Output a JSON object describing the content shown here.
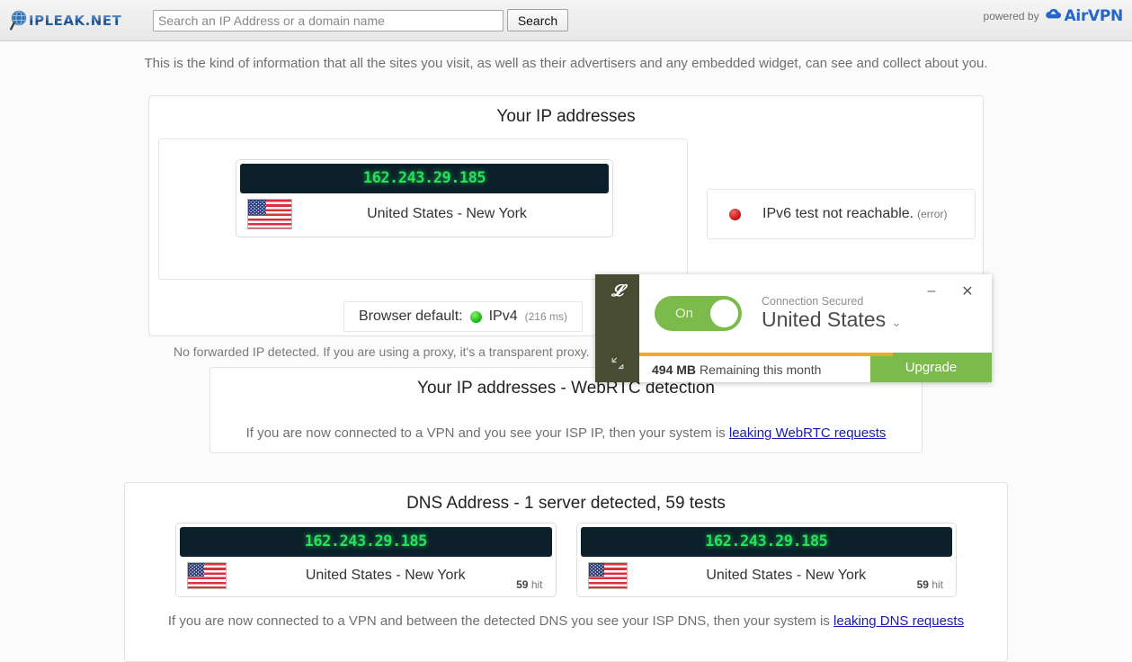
{
  "header": {
    "logo_text": "IPLEAK.NET",
    "logo_icon": "magnifier-globe-icon",
    "search_placeholder": "Search an IP Address or a domain name",
    "search_value": "",
    "search_button": "Search",
    "powered_by_label": "powered by",
    "brand_name": "AirVPN",
    "brand_icon": "airvpn-cloud-icon",
    "brand_color": "#2466c9"
  },
  "intro": "This is the kind of information that all the sites you visit, as well as their advertisers and any embedded widget, can see and collect about you.",
  "ip_panel": {
    "title": "Your IP addresses",
    "ip": "162.243.29.185",
    "location": "United States - New York",
    "flag_icon": "us-flag-icon",
    "forwarded_note": "No forwarded IP detected. If you are using a proxy, it's a transparent proxy.",
    "ipv6": {
      "status_icon": "red-dot-icon",
      "text": "IPv6 test not reachable.",
      "sub": "(error)",
      "color": "#c90d0d"
    },
    "browser_default": {
      "label": "Browser default:",
      "status_icon": "green-dot-icon",
      "value": "IPv4",
      "latency": "(216 ms)",
      "color": "#10b40e"
    }
  },
  "webrtc_panel": {
    "title": "Your IP addresses - WebRTC detection",
    "note_prefix": "If you are now connected to a VPN and you see your ISP IP, then your system is ",
    "link_text": "leaking WebRTC requests"
  },
  "dns_panel": {
    "title": "DNS Address - 1 server detected, 59 tests",
    "cards": [
      {
        "ip": "162.243.29.185",
        "location": "United States - New York",
        "hits": "59",
        "hits_label": "hit",
        "flag_icon": "us-flag-icon"
      },
      {
        "ip": "162.243.29.185",
        "location": "United States - New York",
        "hits": "59",
        "hits_label": "hit",
        "flag_icon": "us-flag-icon"
      }
    ],
    "note_prefix": "If you are now connected to a VPN and between the detected DNS you see your ISP DNS, then your system is ",
    "link_text": "leaking DNS requests"
  },
  "tunnelbear": {
    "logo_icon": "tunnelbear-t-icon",
    "resize_icon": "resize-diagonal-icon",
    "toggle_label": "On",
    "toggle_on": true,
    "toggle_color": "#7cba4c",
    "status_small": "Connection Secured",
    "country": "United States",
    "country_chevron_icon": "chevron-down-icon",
    "minimize_icon": "minimize-icon",
    "close_icon": "close-icon",
    "data_amount": "494 MB",
    "data_text": "Remaining this month",
    "progress_color": "#efa927",
    "upgrade_label": "Upgrade"
  }
}
